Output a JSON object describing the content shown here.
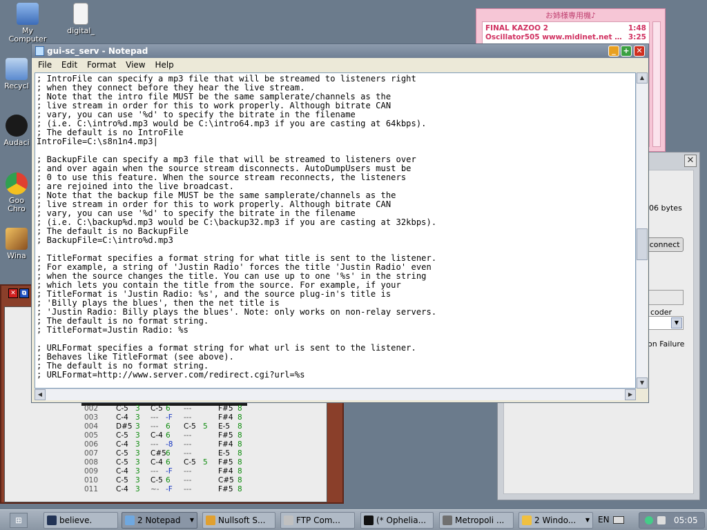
{
  "desktop": {
    "icons": [
      {
        "label": "My Computer",
        "icon": "my-computer-icon",
        "color": "#4a7fd0"
      },
      {
        "label": "digital_",
        "icon": "text-file-icon",
        "color": "#f4f4f4"
      },
      {
        "label": "Recycl",
        "icon": "recycle-bin-icon",
        "color": "#5a8ad0"
      },
      {
        "label": "Audaci",
        "icon": "audacity-icon",
        "color": "#1a1a1a"
      },
      {
        "label": "Goo Chro",
        "icon": "chrome-icon",
        "color": "#e04030"
      },
      {
        "label": "Wina",
        "icon": "winamp-icon",
        "color": "#c08030"
      }
    ]
  },
  "media_window": {
    "title": "お姉様専用機♪",
    "rows": [
      {
        "title": "FINAL KAZOO 2",
        "time": "1:48"
      },
      {
        "title": "Oscillator505 www.midinet.net - A...",
        "time": "3:25"
      }
    ]
  },
  "gray_dialog": {
    "bytes_text": "06 bytes",
    "disconnect_label": "sconnect",
    "encoder_label": "coder",
    "failure_text": "on Failure"
  },
  "tracker": {
    "rows": [
      {
        "num": "002",
        "n1": "C-5",
        "v1": "3",
        "n2": "C-5",
        "v2": "6",
        "n3": "---",
        "v3": "",
        "n4": "F#5",
        "v4": "8"
      },
      {
        "num": "003",
        "n1": "C-4",
        "v1": "3",
        "n2": "---",
        "v2": "-F",
        "n3": "---",
        "v3": "",
        "n4": "F#4",
        "v4": "8"
      },
      {
        "num": "004",
        "n1": "D#5",
        "v1": "3",
        "n2": "---",
        "v2": "6",
        "n3": "C-5",
        "v3": "5",
        "n4": "E-5",
        "v4": "8"
      },
      {
        "num": "005",
        "n1": "C-5",
        "v1": "3",
        "n2": "C-4",
        "v2": "6",
        "n3": "---",
        "v3": "",
        "n4": "F#5",
        "v4": "8"
      },
      {
        "num": "006",
        "n1": "C-4",
        "v1": "3",
        "n2": "---",
        "v2": "-8",
        "n3": "---",
        "v3": "",
        "n4": "F#4",
        "v4": "8"
      },
      {
        "num": "007",
        "n1": "C-5",
        "v1": "3",
        "n2": "C#5",
        "v2": "6",
        "n3": "---",
        "v3": "",
        "n4": "E-5",
        "v4": "8"
      },
      {
        "num": "008",
        "n1": "C-5",
        "v1": "3",
        "n2": "C-4",
        "v2": "6",
        "n3": "C-5",
        "v3": "5",
        "n4": "F#5",
        "v4": "8"
      },
      {
        "num": "009",
        "n1": "C-4",
        "v1": "3",
        "n2": "---",
        "v2": "-F",
        "n3": "---",
        "v3": "",
        "n4": "F#4",
        "v4": "8"
      },
      {
        "num": "010",
        "n1": "C-5",
        "v1": "3",
        "n2": "C-5",
        "v2": "6",
        "n3": "---",
        "v3": "",
        "n4": "C#5",
        "v4": "8"
      },
      {
        "num": "011",
        "n1": "C-4",
        "v1": "3",
        "n2": "~-",
        "v2": "-F",
        "n3": "---",
        "v3": "",
        "n4": "F#5",
        "v4": "8"
      }
    ]
  },
  "notepad": {
    "title": "gui-sc_serv - Notepad",
    "menu": [
      "File",
      "Edit",
      "Format",
      "View",
      "Help"
    ],
    "content": "; IntroFile can specify a mp3 file that will be streamed to listeners right\n; when they connect before they hear the live stream.\n; Note that the intro file MUST be the same samplerate/channels as the\n; live stream in order for this to work properly. Although bitrate CAN\n; vary, you can use '%d' to specify the bitrate in the filename\n; (i.e. C:\\intro%d.mp3 would be C:\\intro64.mp3 if you are casting at 64kbps).\n; The default is no IntroFile\nIntroFile=C:\\s8n1n4.mp3|\n\n; BackupFile can specify a mp3 file that will be streamed to listeners over\n; and over again when the source stream disconnects. AutoDumpUsers must be\n; 0 to use this feature. When the source stream reconnects, the listeners\n; are rejoined into the live broadcast.\n; Note that the backup file MUST be the same samplerate/channels as the\n; live stream in order for this to work properly. Although bitrate CAN\n; vary, you can use '%d' to specify the bitrate in the filename\n; (i.e. C:\\backup%d.mp3 would be C:\\backup32.mp3 if you are casting at 32kbps).\n; The default is no BackupFile\n; BackupFile=C:\\intro%d.mp3\n\n; TitleFormat specifies a format string for what title is sent to the listener.\n; For example, a string of 'Justin Radio' forces the title 'Justin Radio' even\n; when the source changes the title. You can use up to one '%s' in the string\n; which lets you contain the title from the source. For example, if your\n; TitleFormat is 'Justin Radio: %s', and the source plug-in's title is\n; 'Billy plays the blues', then the net title is\n; 'Justin Radio: Billy plays the blues'. Note: only works on non-relay servers.\n; The default is no format string.\n; TitleFormat=Justin Radio: %s\n\n; URLFormat specifies a format string for what url is sent to the listener.\n; Behaves like TitleFormat (see above).\n; The default is no format string.\n; URLFormat=http://www.server.com/redirect.cgi?url=%s"
  },
  "taskbar": {
    "tasks": [
      {
        "label": "believe.",
        "icon": "xm-file-icon",
        "color": "#223355",
        "active": false
      },
      {
        "label": "2 Notepad",
        "icon": "notepad-icon",
        "color": "#6fa8e0",
        "active": true,
        "dropdown": true
      },
      {
        "label": "Nullsoft S...",
        "icon": "nullsoft-icon",
        "color": "#e0a030",
        "active": false
      },
      {
        "label": "FTP Com...",
        "icon": "ftp-icon",
        "color": "#c0c0c0",
        "active": false
      },
      {
        "label": "(* Ophelia...",
        "icon": "media-player-icon",
        "color": "#111111",
        "active": false
      },
      {
        "label": "Metropoli ...",
        "icon": "metropoli-icon",
        "color": "#707070",
        "active": false
      },
      {
        "label": "2 Windo...",
        "icon": "folder-icon",
        "color": "#f0c040",
        "active": false,
        "dropdown": true
      }
    ],
    "language": "EN",
    "clock": "05:05"
  }
}
